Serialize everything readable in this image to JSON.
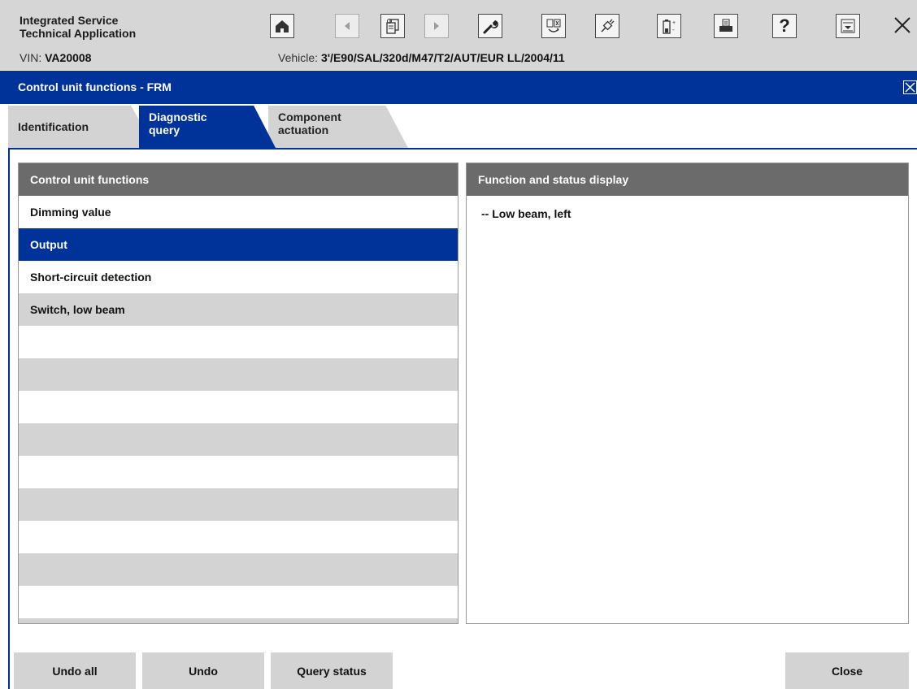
{
  "app": {
    "title_line1": "Integrated Service",
    "title_line2": "Technical Application"
  },
  "toolbar": {
    "buttons": [
      {
        "name": "home-icon",
        "enabled": true
      },
      {
        "name": "back-arrow-icon",
        "enabled": false
      },
      {
        "name": "documents-icon",
        "enabled": true
      },
      {
        "name": "forward-arrow-icon",
        "enabled": false
      },
      {
        "name": "wrench-icon",
        "enabled": true
      },
      {
        "name": "control-unit-swap-icon",
        "enabled": true
      },
      {
        "name": "connection-plug-icon",
        "enabled": true
      },
      {
        "name": "battery-icon",
        "enabled": true
      },
      {
        "name": "printer-icon",
        "enabled": true
      },
      {
        "name": "help-icon",
        "enabled": true
      },
      {
        "name": "minimize-icon",
        "enabled": true
      }
    ],
    "help_glyph": "?",
    "close_glyph": "✕"
  },
  "vehicle_info": {
    "vin_label": "VIN:",
    "vin_value": "VA20008",
    "vehicle_label": "Vehicle:",
    "vehicle_value": "3'/E90/SAL/320d/M47/T2/AUT/EUR LL/2004/11"
  },
  "window": {
    "title": "Control unit functions - FRM"
  },
  "tabs": [
    {
      "line1": "Identification",
      "line2": ""
    },
    {
      "line1": "Diagnostic",
      "line2": "query",
      "active": true
    },
    {
      "line1": "Component",
      "line2": "actuation"
    }
  ],
  "left_panel": {
    "header": "Control unit functions",
    "items": [
      "Dimming value",
      "Output",
      "Short-circuit detection",
      "Switch, low beam"
    ],
    "selected_index": 1
  },
  "right_panel": {
    "header": "Function and status display",
    "status_text": "-- Low beam, left"
  },
  "buttons": {
    "undo_all": "Undo all",
    "undo": "Undo",
    "query_status": "Query status",
    "close": "Close"
  },
  "colors": {
    "accent": "#003399",
    "header_gray": "#6b6b6b",
    "alt_row": "#d3d3d3"
  }
}
